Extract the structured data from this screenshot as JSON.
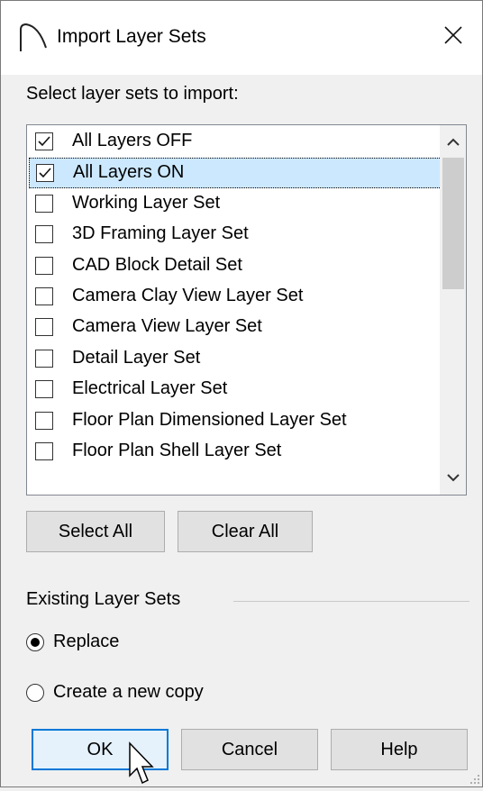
{
  "dialog": {
    "title": "Import Layer Sets",
    "close_icon": "close-icon",
    "app_icon": "arc-icon"
  },
  "list": {
    "label": "Select layer sets to import:",
    "items": [
      {
        "label": "All Layers OFF",
        "checked": true,
        "selected": false
      },
      {
        "label": "All Layers ON",
        "checked": true,
        "selected": true
      },
      {
        "label": "Working Layer Set",
        "checked": false,
        "selected": false
      },
      {
        "label": "3D Framing Layer Set",
        "checked": false,
        "selected": false
      },
      {
        "label": "CAD Block Detail Set",
        "checked": false,
        "selected": false
      },
      {
        "label": "Camera Clay View Layer Set",
        "checked": false,
        "selected": false
      },
      {
        "label": "Camera View Layer Set",
        "checked": false,
        "selected": false
      },
      {
        "label": "Detail Layer Set",
        "checked": false,
        "selected": false
      },
      {
        "label": "Electrical Layer Set",
        "checked": false,
        "selected": false
      },
      {
        "label": "Floor Plan Dimensioned Layer Set",
        "checked": false,
        "selected": false
      },
      {
        "label": "Floor Plan Shell Layer Set",
        "checked": false,
        "selected": false
      }
    ]
  },
  "buttons": {
    "select_all": "Select All",
    "clear_all": "Clear All",
    "ok": "OK",
    "cancel": "Cancel",
    "help": "Help"
  },
  "existing": {
    "label": "Existing Layer Sets",
    "options": [
      {
        "label": "Replace",
        "selected": true
      },
      {
        "label": "Create a new copy",
        "selected": false
      }
    ]
  },
  "colors": {
    "selection": "#cce8ff",
    "default_button_border": "#0078d7"
  }
}
